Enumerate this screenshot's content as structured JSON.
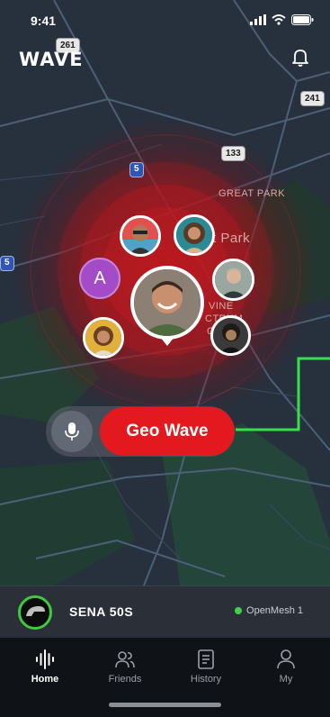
{
  "status_bar": {
    "time": "9:41"
  },
  "app": {
    "logo": "WAVE"
  },
  "map": {
    "highway_shields": [
      "261",
      "241",
      "133",
      "5",
      "5"
    ],
    "labels": [
      "GREAT PARK",
      "t Park",
      "VINE",
      "CTRUM",
      "CEN"
    ]
  },
  "friends_nearby": {
    "letter_avatar": "A"
  },
  "action": {
    "geo_wave_label": "Geo Wave"
  },
  "device": {
    "name": "SENA 50S",
    "network": "OpenMesh 1",
    "network_status_color": "#3fd14a"
  },
  "tabs": [
    {
      "label": "Home",
      "icon": "waveform-icon",
      "active": true
    },
    {
      "label": "Friends",
      "icon": "friends-icon",
      "active": false
    },
    {
      "label": "History",
      "icon": "history-icon",
      "active": false
    },
    {
      "label": "My",
      "icon": "profile-icon",
      "active": false
    }
  ],
  "colors": {
    "accent_red": "#e3191f",
    "highlight_green": "#3ec93e",
    "purple_avatar": "#a44cc7"
  }
}
